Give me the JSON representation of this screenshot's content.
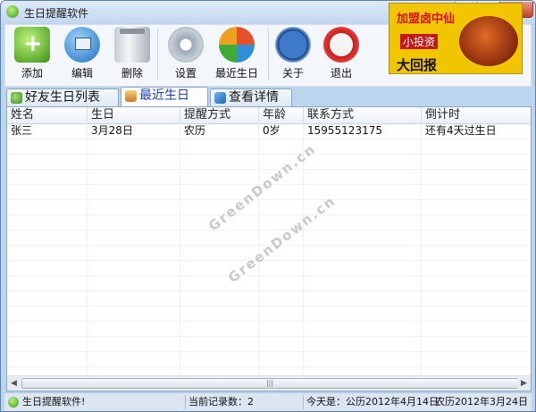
{
  "window": {
    "title": "生日提醒软件"
  },
  "toolbar": {
    "items": [
      {
        "label": "添加",
        "icon": "add-icon"
      },
      {
        "label": "编辑",
        "icon": "edit-icon"
      },
      {
        "label": "删除",
        "icon": "trash-icon"
      },
      {
        "label": "设置",
        "icon": "gear-icon"
      },
      {
        "label": "最近生日",
        "icon": "refresh-icon"
      },
      {
        "label": "关于",
        "icon": "clock-icon"
      },
      {
        "label": "退出",
        "icon": "power-icon"
      }
    ]
  },
  "ad": {
    "line1": "加盟卤中仙",
    "line2": "小投资",
    "line3": "大回报"
  },
  "tabs": [
    {
      "label": "好友生日列表",
      "active": false
    },
    {
      "label": "最近生日",
      "active": true
    },
    {
      "label": "查看详情",
      "active": false
    }
  ],
  "table": {
    "columns": [
      "姓名",
      "生日",
      "提醒方式",
      "年龄",
      "联系方式",
      "倒计时"
    ],
    "rows": [
      [
        "张三",
        "3月28日",
        "农历",
        "0岁",
        "15955123175",
        "还有4天过生日"
      ]
    ]
  },
  "watermark": {
    "text": "GreenDown.cn"
  },
  "status": {
    "app": "生日提醒软件!",
    "records": "当前记录数：2",
    "today": "今天是：公历2012年4月14日",
    "lunar": "农历2012年3月24日"
  },
  "colors": {
    "accent": "#1d3fb0",
    "window_border": "#5a7fa8",
    "close": "#c4402a"
  }
}
